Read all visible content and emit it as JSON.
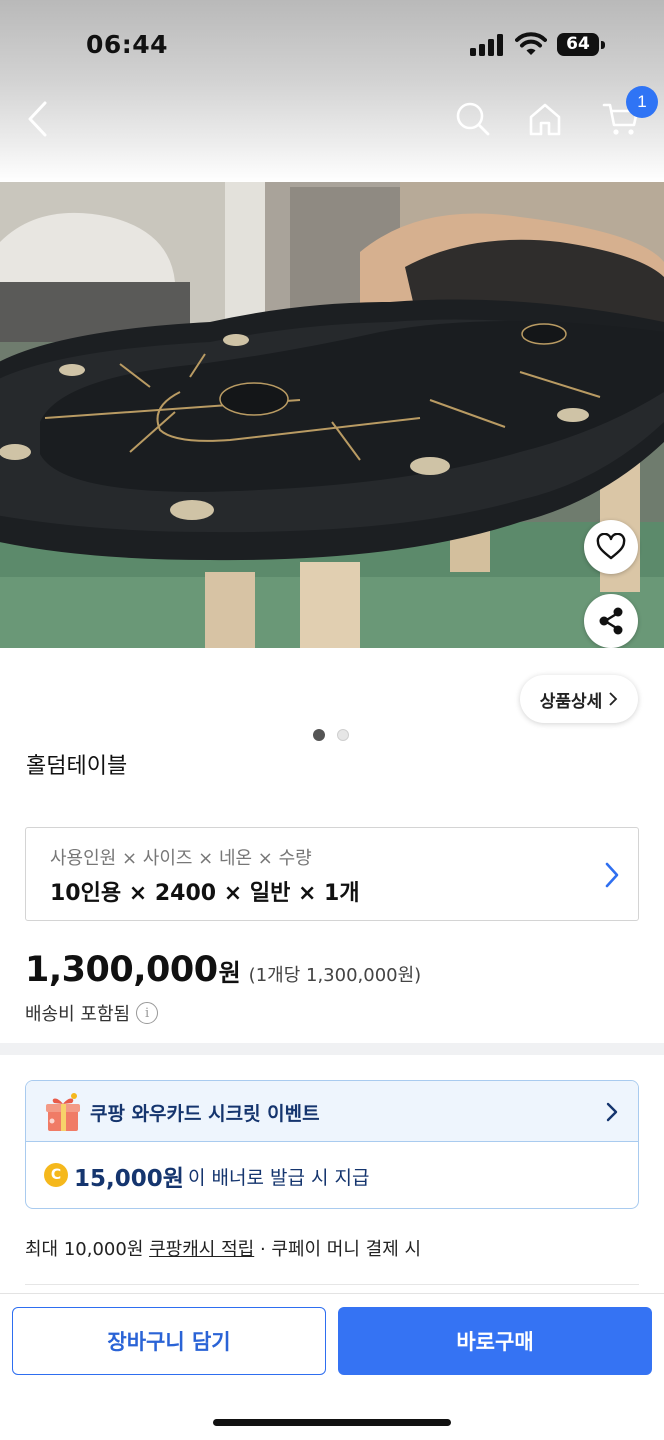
{
  "status_bar": {
    "time": "06:44",
    "battery": "64"
  },
  "nav": {
    "cart_count": "1"
  },
  "image": {
    "current_page": 1,
    "total_pages": 2
  },
  "detail_chip": {
    "label": "상품상세"
  },
  "product": {
    "name": "홀덤테이블"
  },
  "option": {
    "label": "사용인원 × 사이즈 × 네온 × 수량",
    "value": "10인용 × 2400 × 일반 × 1개"
  },
  "price": {
    "amount": "1,300,000",
    "unit": "원",
    "per_unit": "(1개당 1,300,000원)",
    "shipping": "배송비 포함됨"
  },
  "event": {
    "title": "쿠팡 와우카드 시크릿 이벤트",
    "coin": "C",
    "amount": "15,000원",
    "desc": "이 배너로 발급 시 지급"
  },
  "cash": {
    "prefix": "최대 10,000원",
    "link": "쿠팡캐시 적립",
    "suffix": "· 쿠페이 머니 결제 시"
  },
  "actions": {
    "cart_label": "장바구니 담기",
    "buy_label": "바로구매"
  },
  "colors": {
    "accent": "#3573f3",
    "badge": "#2f74f5",
    "event_text": "#15356e",
    "event_bg": "#eef5fd"
  }
}
